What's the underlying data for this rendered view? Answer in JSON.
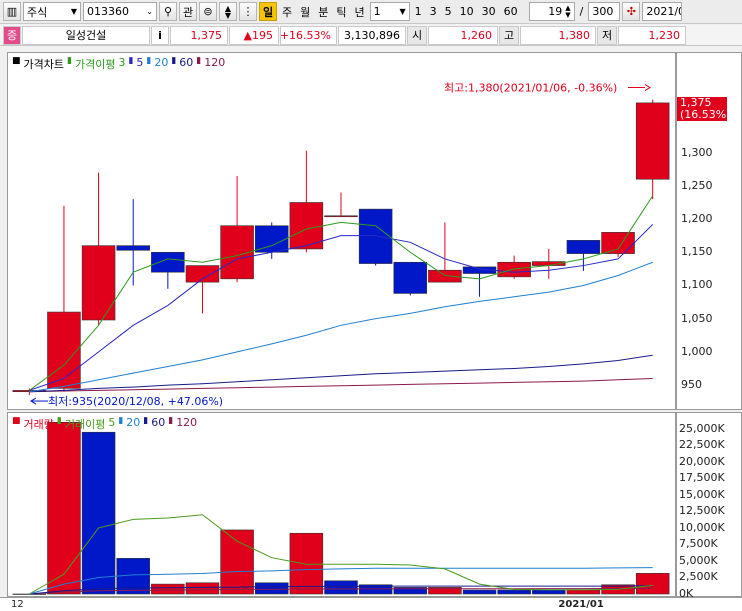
{
  "toolbar": {
    "market_select": "주식",
    "stock_code": "013360",
    "related_label": "관",
    "period_active": "일",
    "periods": [
      "주",
      "월",
      "분",
      "틱",
      "년"
    ],
    "interval_value": "1",
    "interval_buttons": [
      "1",
      "3",
      "5",
      "10",
      "30",
      "60"
    ],
    "view_count": "19",
    "slash": "/",
    "total_count": "300",
    "date": "2021/0"
  },
  "quote": {
    "tag": "증",
    "name": "일성건설",
    "info_label": "i",
    "price": "1,375",
    "change": "▲195",
    "change_rate": "+16.53%",
    "volume": "3,130,896",
    "open_label": "시",
    "open": "1,260",
    "high_label": "고",
    "high": "1,380",
    "low_label": "저",
    "low": "1,230"
  },
  "price_legend": {
    "chart_name": "가격차트",
    "ma_name": "가격이평",
    "ma_periods": [
      "3",
      "5",
      "20",
      "60",
      "120"
    ]
  },
  "volume_legend": {
    "chart_name": "거래량",
    "ma_name": "거래이평",
    "ma_periods": [
      "5",
      "20",
      "60",
      "120"
    ]
  },
  "colors": {
    "up": "#e0001b",
    "down": "#0018c8",
    "ma3": "#2e9a1e",
    "ma5": "#2828c8",
    "ma20": "#1f7fd0",
    "ma60": "#1a1a8c",
    "ma120": "#8c1a4a",
    "vma5": "#4b9a1e",
    "vma20": "#1f7fd0",
    "vma60": "#1a1a8c",
    "vma120": "#8c1a4a"
  },
  "chart_data": [
    {
      "type": "candlestick",
      "title": "가격차트",
      "ylim": [
        920,
        1420
      ],
      "yticks": [
        950,
        1000,
        1050,
        1100,
        1150,
        1200,
        1250,
        1300
      ],
      "current_price_label": "1,375",
      "current_rate_label": "(16.53%)",
      "current_value": 1375,
      "annotations": {
        "high": {
          "text": "최고:1,380(2021/01/06, -0.36%)",
          "value": 1380
        },
        "low": {
          "text": "최저:935(2020/12/08, +47.06%)",
          "value": 935
        }
      },
      "candles": [
        {
          "o": 940,
          "h": 945,
          "l": 935,
          "c": 942
        },
        {
          "o": 945,
          "h": 1220,
          "l": 940,
          "c": 1060
        },
        {
          "o": 1048,
          "h": 1270,
          "l": 1040,
          "c": 1160
        },
        {
          "o": 1160,
          "h": 1230,
          "l": 1100,
          "c": 1153
        },
        {
          "o": 1150,
          "h": 1150,
          "l": 1095,
          "c": 1120
        },
        {
          "o": 1105,
          "h": 1130,
          "l": 1058,
          "c": 1130
        },
        {
          "o": 1110,
          "h": 1265,
          "l": 1105,
          "c": 1190
        },
        {
          "o": 1190,
          "h": 1195,
          "l": 1140,
          "c": 1150
        },
        {
          "o": 1155,
          "h": 1303,
          "l": 1150,
          "c": 1225
        },
        {
          "o": 1205,
          "h": 1240,
          "l": 1205,
          "c": 1205
        },
        {
          "o": 1215,
          "h": 1215,
          "l": 1130,
          "c": 1133
        },
        {
          "o": 1135,
          "h": 1135,
          "l": 1085,
          "c": 1088
        },
        {
          "o": 1105,
          "h": 1195,
          "l": 1105,
          "c": 1123
        },
        {
          "o": 1128,
          "h": 1128,
          "l": 1083,
          "c": 1118
        },
        {
          "o": 1113,
          "h": 1145,
          "l": 1110,
          "c": 1135
        },
        {
          "o": 1130,
          "h": 1155,
          "l": 1110,
          "c": 1136
        },
        {
          "o": 1168,
          "h": 1168,
          "l": 1122,
          "c": 1148
        },
        {
          "o": 1148,
          "h": 1180,
          "l": 1143,
          "c": 1180
        },
        {
          "o": 1260,
          "h": 1380,
          "l": 1230,
          "c": 1375
        }
      ],
      "ma": {
        "ma3": [
          942,
          980,
          1040,
          1120,
          1140,
          1135,
          1145,
          1160,
          1185,
          1195,
          1190,
          1150,
          1115,
          1110,
          1125,
          1130,
          1140,
          1155,
          1235
        ],
        "ma5": [
          942,
          960,
          1000,
          1040,
          1070,
          1110,
          1140,
          1150,
          1160,
          1175,
          1175,
          1165,
          1140,
          1125,
          1120,
          1123,
          1130,
          1140,
          1192
        ],
        "ma20": [
          940,
          948,
          958,
          968,
          978,
          988,
          1000,
          1012,
          1025,
          1040,
          1050,
          1058,
          1068,
          1076,
          1083,
          1090,
          1100,
          1115,
          1135
        ],
        "ma60": [
          940,
          942,
          945,
          947,
          950,
          952,
          955,
          958,
          961,
          964,
          967,
          969,
          971,
          973,
          975,
          978,
          982,
          987,
          995
        ],
        "ma120": [
          940,
          941,
          942,
          943,
          944,
          945,
          946,
          947,
          948,
          949,
          950,
          951,
          952,
          953,
          954,
          955,
          956,
          958,
          960
        ]
      }
    },
    {
      "type": "bar",
      "title": "거래량",
      "ylim": [
        0,
        26500
      ],
      "yticks": [
        "25,000K",
        "22,500K",
        "20,000K",
        "17,500K",
        "15,000K",
        "12,500K",
        "10,000K",
        "7,500K",
        "5,000K",
        "2,500K",
        "0K"
      ],
      "ytick_values": [
        25000,
        22500,
        20000,
        17500,
        15000,
        12500,
        10000,
        7500,
        5000,
        2500,
        0
      ],
      "values": [
        0,
        26000,
        24500,
        5400,
        1500,
        1700,
        9700,
        1700,
        9200,
        2000,
        1400,
        1000,
        1000,
        600,
        600,
        600,
        600,
        1400,
        3130
      ],
      "up": [
        false,
        true,
        false,
        false,
        true,
        true,
        true,
        false,
        true,
        false,
        false,
        false,
        true,
        false,
        false,
        false,
        true,
        true,
        true
      ],
      "ma": {
        "vma5": [
          0,
          3000,
          10000,
          11300,
          11500,
          12000,
          8000,
          5500,
          4500,
          4500,
          4500,
          4400,
          3800,
          1500,
          700,
          650,
          650,
          700,
          1300
        ],
        "vma20": [
          0,
          1500,
          2500,
          2900,
          3000,
          3100,
          3400,
          3500,
          3700,
          3800,
          3900,
          3900,
          3900,
          3900,
          3900,
          3900,
          3900,
          3950,
          4000
        ],
        "vma60": [
          0,
          500,
          800,
          900,
          950,
          1000,
          1050,
          1100,
          1150,
          1150,
          1200,
          1200,
          1200,
          1200,
          1200,
          1200,
          1200,
          1200,
          1250
        ],
        "vma120": [
          0,
          300,
          500,
          550,
          600,
          650,
          700,
          700,
          750,
          750,
          780,
          800,
          800,
          800,
          800,
          820,
          820,
          840,
          860
        ]
      },
      "x_labels": [
        {
          "text": "12",
          "index": 0
        },
        {
          "text": "2021/01",
          "index": 16
        }
      ]
    }
  ]
}
